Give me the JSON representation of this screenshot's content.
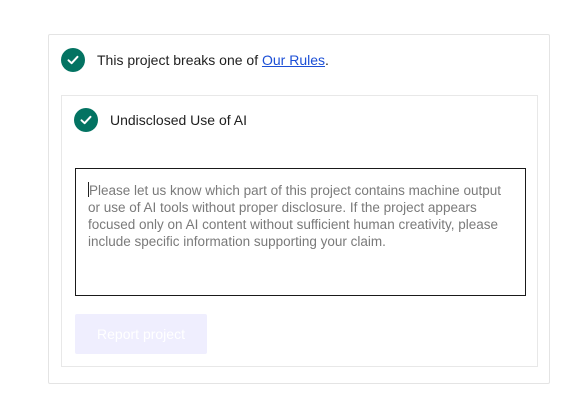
{
  "report": {
    "rule_statement_prefix": "This project breaks one of ",
    "rule_link_text": "Our Rules",
    "rule_statement_suffix": ".",
    "selected_reason": "Undisclosed Use of AI",
    "details_placeholder": "Please let us know which part of this project contains machine output or use of AI tools without proper disclosure. If the project appears focused only on AI content without sufficient human creativity, please include specific information supporting your claim.",
    "details_value": "",
    "submit_label": "Report project",
    "submit_enabled": false
  },
  "icons": {
    "rule_check": "check-circle-icon",
    "reason_check": "check-circle-icon"
  },
  "colors": {
    "check_fill": "#037362",
    "link": "#1c4fd6",
    "button_disabled_bg": "#efeefe"
  }
}
